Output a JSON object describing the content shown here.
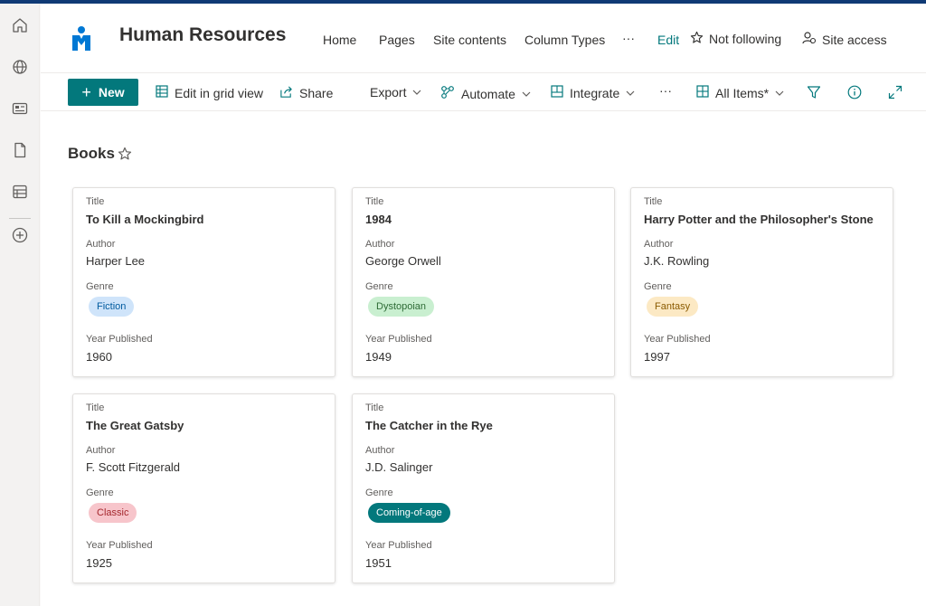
{
  "site": {
    "title": "Human Resources",
    "nav": [
      "Home",
      "Pages",
      "Site contents",
      "Column Types"
    ],
    "more": "···",
    "edit": "Edit",
    "follow": "Not following",
    "access": "Site access"
  },
  "toolbar": {
    "new": "New",
    "grid": "Edit in grid view",
    "share": "Share",
    "export": "Export",
    "automate": "Automate",
    "integrate": "Integrate",
    "more": "···",
    "view": "All Items*"
  },
  "list": {
    "title": "Books",
    "labels": {
      "title": "Title",
      "author": "Author",
      "genre": "Genre",
      "year": "Year Published"
    },
    "items": [
      {
        "title": "To Kill a Mockingbird",
        "author": "Harper Lee",
        "genre": "Fiction",
        "year": "1960"
      },
      {
        "title": "1984",
        "author": "George Orwell",
        "genre": "Dystopoian",
        "year": "1949"
      },
      {
        "title": "Harry Potter and the Philosopher's Stone",
        "author": "J.K. Rowling",
        "genre": "Fantasy",
        "year": "1997"
      },
      {
        "title": "The Great Gatsby",
        "author": "F. Scott Fitzgerald",
        "genre": "Classic",
        "year": "1925"
      },
      {
        "title": "The Catcher in the Rye",
        "author": "J.D. Salinger",
        "genre": "Coming-of-age",
        "year": "1951"
      }
    ]
  },
  "colors": {
    "accent": "#03787c",
    "fiction": "#cfe4fa",
    "dystopian": "#c9efd0",
    "fantasy": "#fce9c4",
    "classic": "#f7c5cb",
    "coming_of_age": "#03787c"
  }
}
